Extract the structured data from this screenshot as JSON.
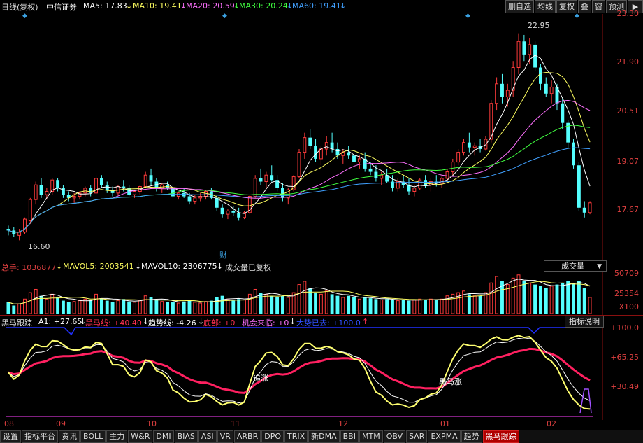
{
  "header": {
    "period": "日线(复权)",
    "stock": "中信证券",
    "ma5": "MA5: 17.83",
    "ma10": "MA10: 19.41",
    "ma20": "MA20: 20.59",
    "ma30": "MA30: 20.24",
    "ma60": "MA60: 19.41",
    "arrow": "↓",
    "buttons": [
      "删自选",
      "均线",
      "复权",
      "叠",
      "窗",
      "预测"
    ],
    "nav_glyph": "▶"
  },
  "price_axis": {
    "labels": [
      "23.30",
      "21.90",
      "20.51",
      "19.07",
      "17.67"
    ],
    "high_label": "22.95",
    "low_label": "16.60",
    "cai_label": "财"
  },
  "volume": {
    "total": "总手: 1036877",
    "mavol5": "MAVOL5: 2003541",
    "mavol10": "MAVOL10: 2306775",
    "note": "成交量已复权",
    "dropdown": "成交量",
    "axis": [
      "50709",
      "25354",
      "X100"
    ]
  },
  "indicator": {
    "name": "黑马跟踪",
    "a1": "A1: +27.65",
    "heima": "黑马线: +40.40",
    "trend": "趋势线: -4.26",
    "bottom": "底部: +0",
    "chance": "机会来临: +0",
    "big": "大势已去: +100.0",
    "arrow_down": "↓",
    "arrow_up": "↑",
    "explain": "指标说明",
    "axis": [
      "+100.0",
      "+65.25",
      "+30.49"
    ],
    "text1": "追涨",
    "text2": "黑马涨"
  },
  "time_axis": [
    "08",
    "09",
    "10",
    "11",
    "12",
    "01",
    "02"
  ],
  "tabs": [
    "设置",
    "指标平台",
    "资讯",
    "BOLL",
    "主力",
    "W&R",
    "DMI",
    "BIAS",
    "ASI",
    "VR",
    "ARBR",
    "DPO",
    "TRIX",
    "新DMA",
    "BBI",
    "MTM",
    "OBV",
    "SAR",
    "EXPMA",
    "趋势",
    "黑马跟踪"
  ],
  "active_tab": "黑马跟踪",
  "colors": {
    "up": "#ff3b3b",
    "down": "#54ffff",
    "ma5": "#ffffff",
    "ma10": "#ffff60",
    "ma20": "#ff70ff",
    "ma30": "#40ff40",
    "ma60": "#40a0ff",
    "axis": "#e04040"
  },
  "chart_data": {
    "type": "candlestick",
    "ylim": [
      16.2,
      23.5
    ],
    "ohlc": [
      [
        16.95,
        17.05,
        16.75,
        16.9
      ],
      [
        16.9,
        17.0,
        16.7,
        16.8
      ],
      [
        16.75,
        16.95,
        16.6,
        16.85
      ],
      [
        16.85,
        17.3,
        16.8,
        17.25
      ],
      [
        17.2,
        17.9,
        17.1,
        17.85
      ],
      [
        17.85,
        18.4,
        17.7,
        18.3
      ],
      [
        18.3,
        18.5,
        17.9,
        18.0
      ],
      [
        18.0,
        18.2,
        17.85,
        18.1
      ],
      [
        18.1,
        18.5,
        18.0,
        18.45
      ],
      [
        18.45,
        18.5,
        18.1,
        18.2
      ],
      [
        18.2,
        18.3,
        17.9,
        18.0
      ],
      [
        18.0,
        18.1,
        17.8,
        17.9
      ],
      [
        17.9,
        18.05,
        17.75,
        17.95
      ],
      [
        17.95,
        18.1,
        17.85,
        18.05
      ],
      [
        18.05,
        18.25,
        17.95,
        18.2
      ],
      [
        18.2,
        18.3,
        17.95,
        18.05
      ],
      [
        18.05,
        18.6,
        18.0,
        18.5
      ],
      [
        18.5,
        18.6,
        18.2,
        18.3
      ],
      [
        18.3,
        18.4,
        18.05,
        18.15
      ],
      [
        18.15,
        18.25,
        17.95,
        18.05
      ],
      [
        18.05,
        18.3,
        18.0,
        18.25
      ],
      [
        18.25,
        18.45,
        18.1,
        18.2
      ],
      [
        18.2,
        18.3,
        17.95,
        18.0
      ],
      [
        18.0,
        18.15,
        17.9,
        18.1
      ],
      [
        18.1,
        18.3,
        18.0,
        18.25
      ],
      [
        18.25,
        18.7,
        18.2,
        18.6
      ],
      [
        18.6,
        18.8,
        18.3,
        18.4
      ],
      [
        18.4,
        18.5,
        18.1,
        18.2
      ],
      [
        18.2,
        18.35,
        18.05,
        18.3
      ],
      [
        18.3,
        18.4,
        18.15,
        18.2
      ],
      [
        18.2,
        18.3,
        17.9,
        17.95
      ],
      [
        17.95,
        18.1,
        17.85,
        18.05
      ],
      [
        18.05,
        18.2,
        17.9,
        17.95
      ],
      [
        17.95,
        18.05,
        17.7,
        17.8
      ],
      [
        17.8,
        18.0,
        17.7,
        17.9
      ],
      [
        17.9,
        18.05,
        17.8,
        17.95
      ],
      [
        17.95,
        18.15,
        17.85,
        18.1
      ],
      [
        18.1,
        18.2,
        17.85,
        17.9
      ],
      [
        17.9,
        18.0,
        17.5,
        17.6
      ],
      [
        17.6,
        17.7,
        17.3,
        17.4
      ],
      [
        17.4,
        17.55,
        17.25,
        17.5
      ],
      [
        17.5,
        17.65,
        17.35,
        17.45
      ],
      [
        17.45,
        17.6,
        17.2,
        17.3
      ],
      [
        17.3,
        17.5,
        17.25,
        17.45
      ],
      [
        17.45,
        18.0,
        17.4,
        17.95
      ],
      [
        17.95,
        18.6,
        17.9,
        18.5
      ],
      [
        18.5,
        18.8,
        18.3,
        18.4
      ],
      [
        18.4,
        18.7,
        18.2,
        18.6
      ],
      [
        18.6,
        18.9,
        18.4,
        18.45
      ],
      [
        18.45,
        18.6,
        18.1,
        18.2
      ],
      [
        18.2,
        18.35,
        17.8,
        17.9
      ],
      [
        17.9,
        18.2,
        17.7,
        18.15
      ],
      [
        18.15,
        18.6,
        18.1,
        18.55
      ],
      [
        18.55,
        19.4,
        18.5,
        19.3
      ],
      [
        19.3,
        19.9,
        19.1,
        19.75
      ],
      [
        19.75,
        20.0,
        19.4,
        19.5
      ],
      [
        19.5,
        19.7,
        19.0,
        19.1
      ],
      [
        19.1,
        19.5,
        18.9,
        19.4
      ],
      [
        19.4,
        19.8,
        19.2,
        19.6
      ],
      [
        19.6,
        19.9,
        19.3,
        19.4
      ],
      [
        19.4,
        19.6,
        19.1,
        19.2
      ],
      [
        19.2,
        19.4,
        18.95,
        19.3
      ],
      [
        19.3,
        19.5,
        19.1,
        19.2
      ],
      [
        19.2,
        19.35,
        18.9,
        19.0
      ],
      [
        19.0,
        19.2,
        18.8,
        19.1
      ],
      [
        19.1,
        19.3,
        18.7,
        18.8
      ],
      [
        18.8,
        19.0,
        18.6,
        18.7
      ],
      [
        18.7,
        18.9,
        18.4,
        18.5
      ],
      [
        18.5,
        18.7,
        18.3,
        18.6
      ],
      [
        18.6,
        18.8,
        18.35,
        18.4
      ],
      [
        18.4,
        18.6,
        18.1,
        18.2
      ],
      [
        18.2,
        18.5,
        18.1,
        18.4
      ],
      [
        18.4,
        18.6,
        18.2,
        18.3
      ],
      [
        18.3,
        18.5,
        18.0,
        18.1
      ],
      [
        18.1,
        18.3,
        17.95,
        18.2
      ],
      [
        18.2,
        18.5,
        18.15,
        18.45
      ],
      [
        18.45,
        18.6,
        18.2,
        18.3
      ],
      [
        18.3,
        18.5,
        18.1,
        18.4
      ],
      [
        18.4,
        18.6,
        18.25,
        18.35
      ],
      [
        18.35,
        18.55,
        18.2,
        18.5
      ],
      [
        18.5,
        18.8,
        18.4,
        18.7
      ],
      [
        18.7,
        19.1,
        18.6,
        19.0
      ],
      [
        19.0,
        19.4,
        18.9,
        19.3
      ],
      [
        19.3,
        19.7,
        19.2,
        19.6
      ],
      [
        19.6,
        19.9,
        19.3,
        19.45
      ],
      [
        19.45,
        19.6,
        19.2,
        19.5
      ],
      [
        19.5,
        19.7,
        19.3,
        19.4
      ],
      [
        19.4,
        19.8,
        19.35,
        19.7
      ],
      [
        19.7,
        20.9,
        19.6,
        20.8
      ],
      [
        20.8,
        21.6,
        20.6,
        21.4
      ],
      [
        21.4,
        21.7,
        20.8,
        21.0
      ],
      [
        21.0,
        21.4,
        20.7,
        21.2
      ],
      [
        21.2,
        22.1,
        21.0,
        21.9
      ],
      [
        21.9,
        22.95,
        21.7,
        22.7
      ],
      [
        22.7,
        22.9,
        22.1,
        22.3
      ],
      [
        22.3,
        22.8,
        22.0,
        22.6
      ],
      [
        22.6,
        22.7,
        21.8,
        21.9
      ],
      [
        21.9,
        22.0,
        21.2,
        21.4
      ],
      [
        21.4,
        21.6,
        21.0,
        21.1
      ],
      [
        21.1,
        21.5,
        20.8,
        21.3
      ],
      [
        21.3,
        21.4,
        20.6,
        20.8
      ],
      [
        20.8,
        21.0,
        20.0,
        20.2
      ],
      [
        20.2,
        20.3,
        19.4,
        19.6
      ],
      [
        19.6,
        19.7,
        18.8,
        18.9
      ],
      [
        18.9,
        19.0,
        17.5,
        17.6
      ],
      [
        17.6,
        17.8,
        17.3,
        17.45
      ],
      [
        17.45,
        17.8,
        17.4,
        17.75
      ]
    ],
    "volume": [
      14,
      10,
      12,
      18,
      26,
      30,
      22,
      18,
      24,
      20,
      16,
      14,
      15,
      16,
      18,
      17,
      24,
      19,
      16,
      14,
      16,
      18,
      15,
      14,
      16,
      22,
      20,
      17,
      15,
      14,
      14,
      13,
      15,
      16,
      14,
      13,
      15,
      16,
      20,
      22,
      18,
      16,
      18,
      17,
      24,
      30,
      26,
      24,
      22,
      20,
      22,
      20,
      26,
      36,
      40,
      32,
      26,
      24,
      28,
      24,
      22,
      20,
      22,
      20,
      18,
      20,
      19,
      18,
      17,
      18,
      17,
      16,
      17,
      16,
      17,
      18,
      17,
      18,
      17,
      18,
      22,
      24,
      26,
      28,
      24,
      22,
      22,
      26,
      38,
      46,
      40,
      36,
      44,
      48,
      40,
      38,
      36,
      34,
      32,
      34,
      36,
      38,
      40,
      38,
      40,
      32,
      20
    ]
  }
}
